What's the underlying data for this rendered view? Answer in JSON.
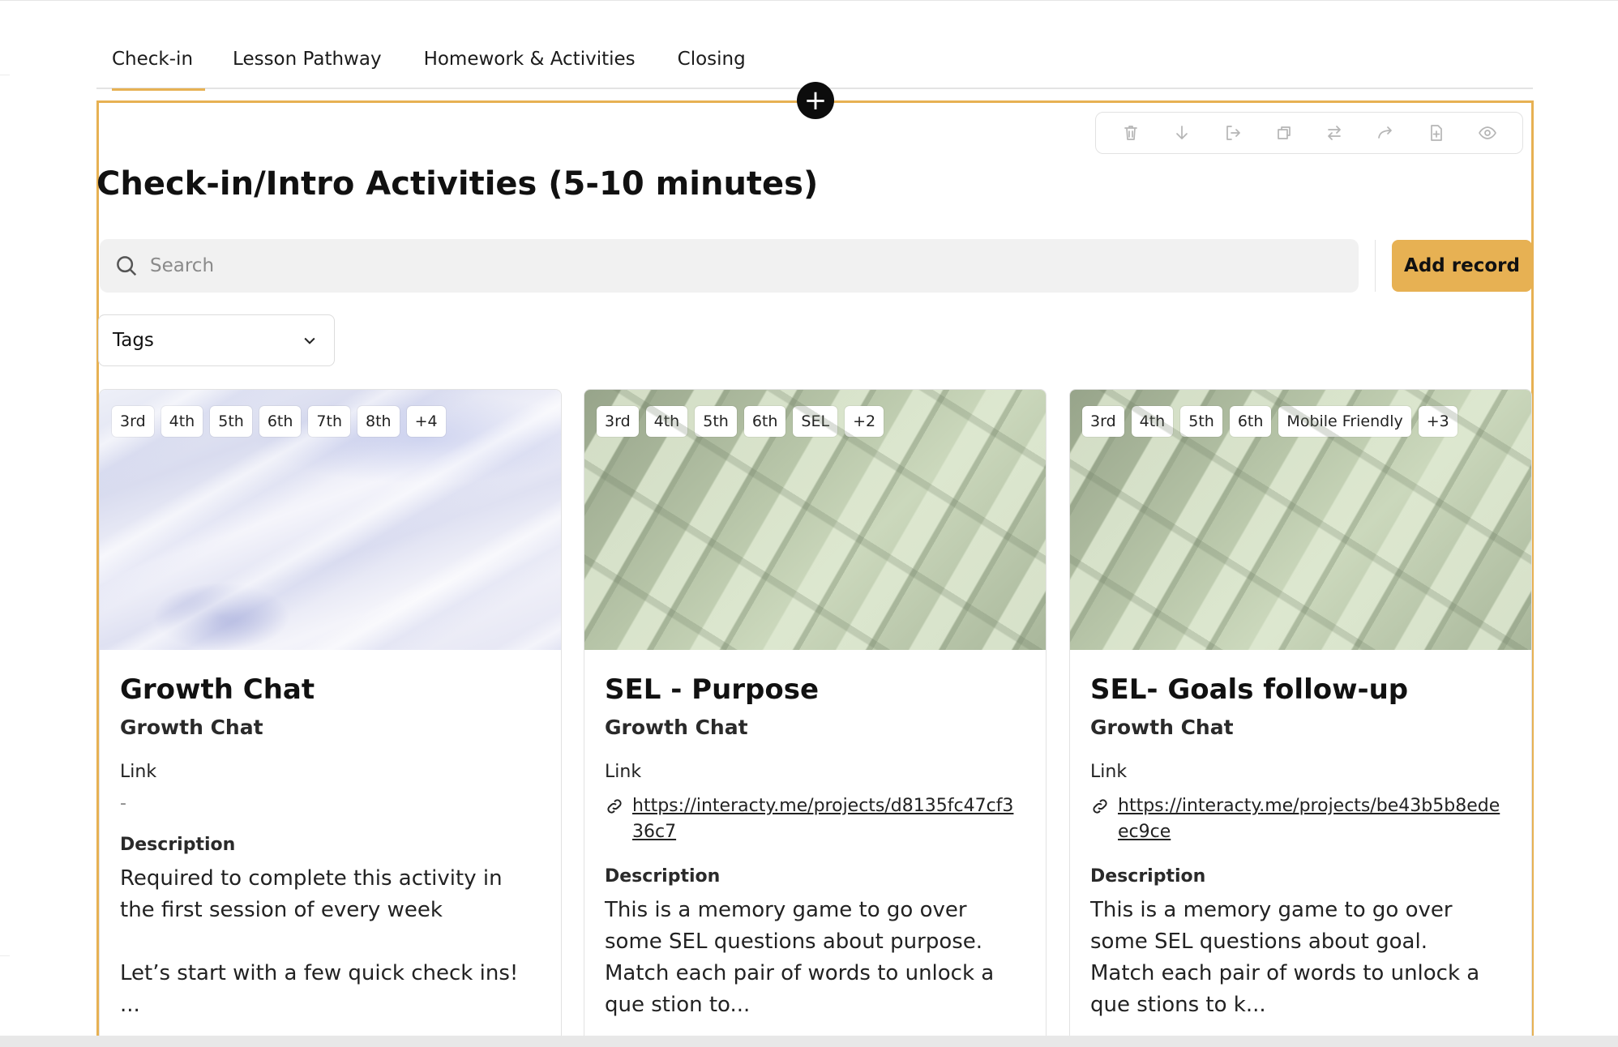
{
  "tabs": [
    {
      "label": "Check-in",
      "active": true
    },
    {
      "label": "Lesson Pathway",
      "active": false
    },
    {
      "label": "Homework & Activities",
      "active": false
    },
    {
      "label": "Closing",
      "active": false
    }
  ],
  "add_block_symbol": "+",
  "toolbar": [
    "trash-icon",
    "arrow-down-icon",
    "move-out-icon",
    "duplicate-icon",
    "swap-icon",
    "redo-icon",
    "add-page-icon",
    "eye-icon"
  ],
  "section": {
    "title": "Check-in/Intro Activities (5-10 minutes)",
    "search_placeholder": "Search",
    "add_record_label": "Add record",
    "tags_label": "Tags"
  },
  "accent_color": "#e7b153",
  "cards": [
    {
      "chips": [
        "3rd",
        "4th",
        "5th",
        "6th",
        "7th",
        "8th",
        "+4"
      ],
      "title": "Growth Chat",
      "subtitle": "Growth Chat",
      "link_label": "Link",
      "link": "-",
      "description_label": "Description",
      "description": "Required to complete this activity in the first session of every week\n\nLet’s start with a few quick check ins!\n..."
    },
    {
      "chips": [
        "3rd",
        "4th",
        "5th",
        "6th",
        "SEL",
        "+2"
      ],
      "title": "SEL - Purpose",
      "subtitle": "Growth Chat",
      "link_label": "Link",
      "link": "https://interacty.me/projects/d8135fc47cf336c7",
      "description_label": "Description",
      "description": "This is a memory game to go over some SEL questions about purpose.\nMatch each pair of words to unlock a que stion to..."
    },
    {
      "chips": [
        "3rd",
        "4th",
        "5th",
        "6th",
        "Mobile Friendly",
        "+3"
      ],
      "title": "SEL- Goals follow-up",
      "subtitle": "Growth Chat",
      "link_label": "Link",
      "link": "https://interacty.me/projects/be43b5b8edeec9ce",
      "description_label": "Description",
      "description": "This is a memory game to go over some SEL questions about goal.\nMatch each pair of words to unlock a que stions to k..."
    }
  ]
}
